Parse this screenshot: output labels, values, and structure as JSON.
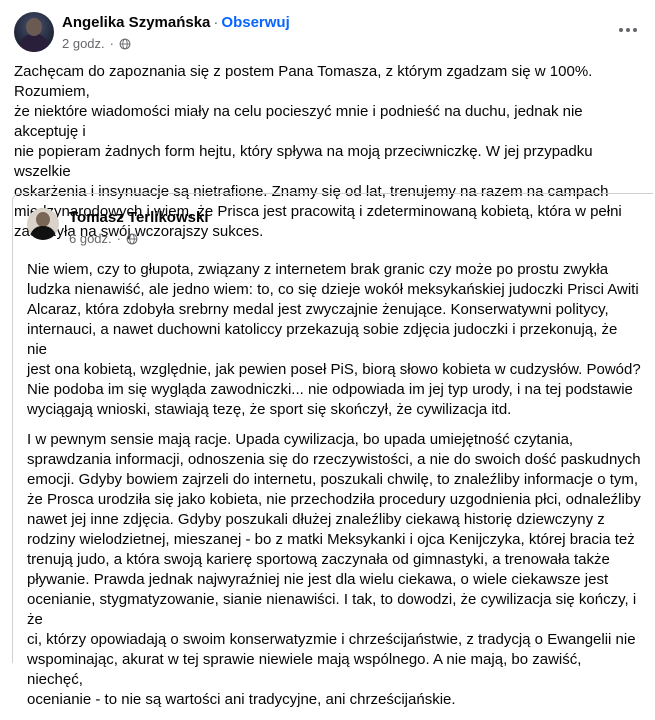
{
  "post": {
    "author": "Angelika Szymańska",
    "separator": "·",
    "follow_label": "Obserwuj",
    "time": "2 godz.",
    "globe_icon": "globe-icon",
    "more_icon": "more-options-icon",
    "text": "Zachęcam do zapoznania się z postem Pana Tomasza, z którym zgadzam się w 100%. Rozumiem,\nże niektóre wiadomości miały na celu pocieszyć mnie i podnieść na duchu, jednak nie akceptuję i\nnie popieram żadnych form hejtu, który spływa na moją przeciwniczkę. W jej przypadku wszelkie\noskarżenia i insynuacje są nietrafione. Znamy się od lat, trenujemy na razem na campach\nmiędzynarodowych i wiem, że Prisca jest pracowitą i zdeterminowaną kobietą, która w pełni\nzasłużyła na swój wczorajszy sukces."
  },
  "shared": {
    "author": "Tomasz Terlikowski",
    "time": "6 godz.",
    "paragraph1": "Nie wiem, czy to głupota, związany z internetem brak granic czy może po prostu zwykła\nludzka nienawiść, ale jedno wiem: to, co się dzieje wokół meksykańskiej judoczki Prisci Awiti\nAlcaraz, która zdobyła srebrny medal jest zwyczajnie żenujące.  Konserwatywni politycy,\ninternauci, a nawet duchowni katoliccy przekazują sobie zdjęcia judoczki i przekonują, że nie\njest ona kobietą, względnie, jak pewien poseł PiS, biorą słowo kobieta w cudzysłów. Powód?\nNie podoba im się wygląda zawodniczki... nie odpowiada im jej typ urody, i na tej podstawie\nwyciągają wnioski, stawiają tezę, że sport się skończył, że cywilizacja itd.",
    "paragraph2": "I w pewnym sensie mają racje. Upada cywilizacja, bo upada umiejętność czytania,\nsprawdzania informacji, odnoszenia się do rzeczywistości, a nie do swoich dość paskudnych\nemocji. Gdyby bowiem zajrzeli do internetu, poszukali chwilę, to znaleźliby informacje o tym,\nże Prosca urodziła się jako kobieta, nie przechodziła procedury uzgodnienia płci, odnaleźliby\nnawet jej inne zdjęcia. Gdyby poszukali dłużej znaleźliby ciekawą historię dziewczyny z\nrodziny wielodzietnej, mieszanej - bo z matki Meksykanki i ojca Kenijczyka, której bracia też\ntrenują judo, a która swoją karierę sportową zaczynała od gimnastyki, a trenowała także\npływanie. Prawda jednak najwyraźniej nie jest dla wielu ciekawa, o wiele ciekawsze jest\nocenianie, stygmatyzowanie, sianie nienawiści. I tak, to dowodzi, że cywilizacja się kończy, i że\nci, którzy opowiadają o swoim konserwatyzmie i chrześcijaństwie, z tradycją o Ewangelii nie\nwspominając, akurat w tej sprawie niewiele mają wspólnego. A nie mają, bo zawiść, niechęć,\nocenianie - to nie są wartości ani tradycyjne, ani chrześcijańskie."
  }
}
